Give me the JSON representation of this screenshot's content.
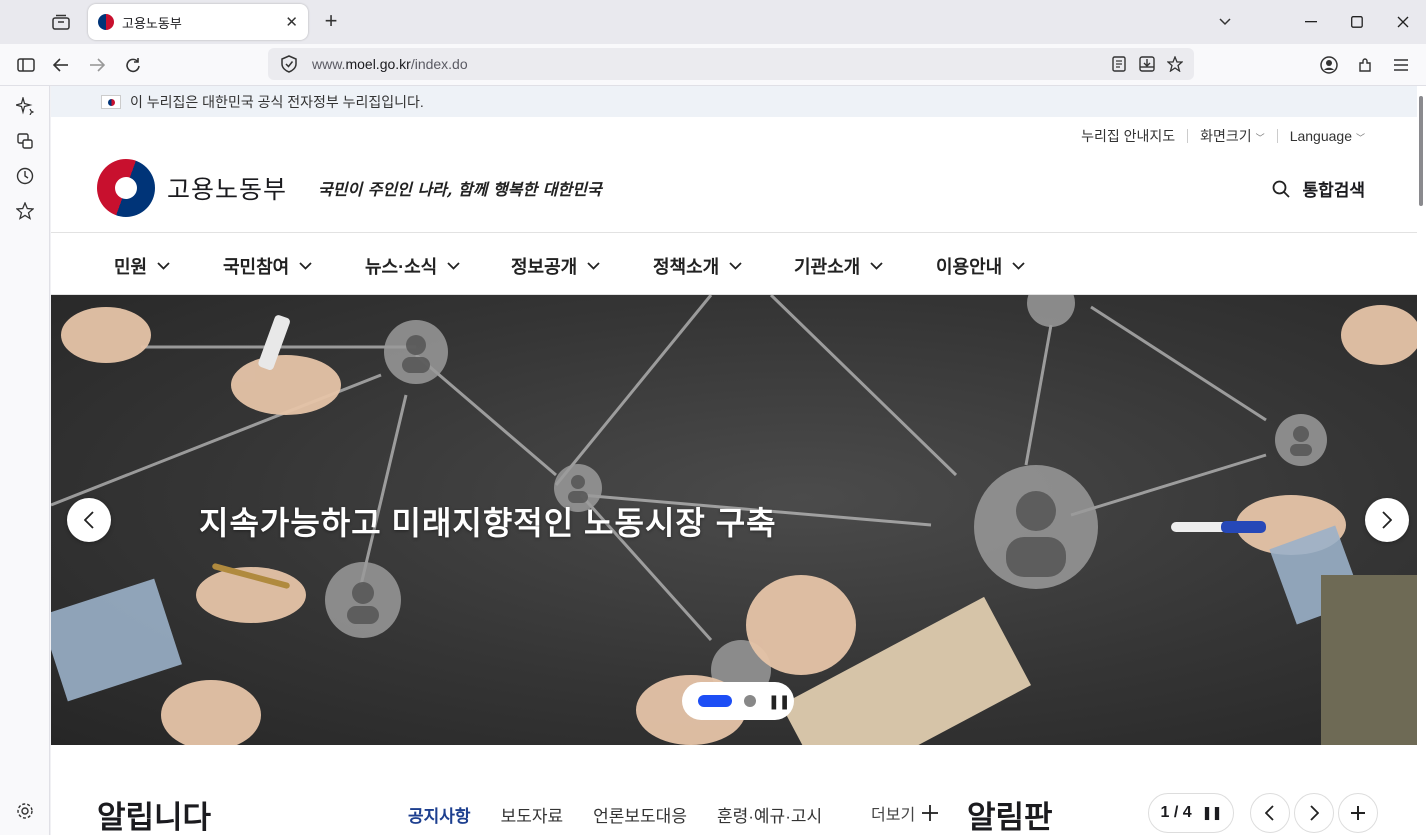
{
  "browser": {
    "tab_title": "고용노동부",
    "url_prefix": "www.",
    "url_domain": "moel.go.kr",
    "url_path": "/index.do",
    "tab_close": "✕",
    "new_tab": "+"
  },
  "page": {
    "gov_banner": "이 누리집은 대한민국 공식 전자정부 누리집입니다.",
    "util_links": [
      "누리집 안내지도",
      "화면크기",
      "Language"
    ],
    "logo_text": "고용노동부",
    "slogan": "국민이 주인인 나라, 함께 행복한 대한민국",
    "search_label": "통합검색",
    "gnb": [
      "민원",
      "국민참여",
      "뉴스·소식",
      "정보공개",
      "정책소개",
      "기관소개",
      "이용안내"
    ],
    "hero_text": "지속가능하고 미래지향적인 노동시장 구축",
    "notice_title": "알립니다",
    "notice_tabs": [
      "공지사항",
      "보도자료",
      "언론보도대응",
      "훈령·예규·고시"
    ],
    "more_label": "더보기",
    "board_title": "알림판",
    "board_page": "1 / 4"
  },
  "colors": {
    "accent": "#1d4ef5",
    "brand_red": "#c8102e",
    "brand_blue": "#003478"
  }
}
